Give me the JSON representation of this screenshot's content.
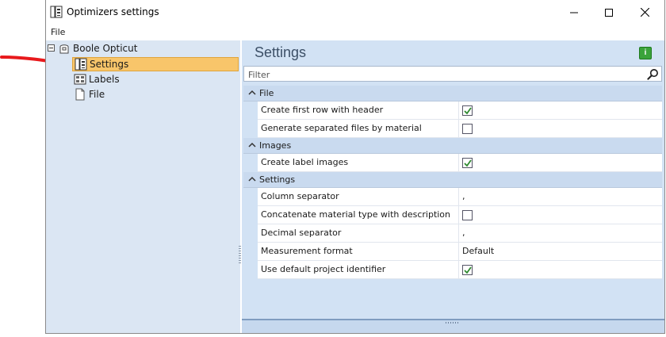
{
  "window": {
    "title": "Optimizers settings",
    "menu": {
      "file": "File"
    }
  },
  "tree": {
    "root": {
      "label": "Boole Opticut",
      "icon": "machine-icon"
    },
    "items": [
      {
        "label": "Settings",
        "icon": "settings-icon",
        "selected": true
      },
      {
        "label": "Labels",
        "icon": "labels-icon",
        "selected": false
      },
      {
        "label": "File",
        "icon": "file-icon",
        "selected": false
      }
    ]
  },
  "panel": {
    "title": "Settings",
    "info_button": "i",
    "filter_placeholder": "Filter"
  },
  "categories": [
    {
      "label": "File",
      "rows": [
        {
          "name": "Create first row with header",
          "type": "checkbox",
          "checked": true
        },
        {
          "name": "Generate separated files by material",
          "type": "checkbox",
          "checked": false
        }
      ]
    },
    {
      "label": "Images",
      "rows": [
        {
          "name": "Create label images",
          "type": "checkbox",
          "checked": true
        }
      ]
    },
    {
      "label": "Settings",
      "rows": [
        {
          "name": "Column separator",
          "type": "text",
          "value": ","
        },
        {
          "name": "Concatenate material type with description",
          "type": "checkbox",
          "checked": false
        },
        {
          "name": "Decimal separator",
          "type": "text",
          "value": ","
        },
        {
          "name": "Measurement format",
          "type": "text",
          "value": "Default"
        },
        {
          "name": "Use default project identifier",
          "type": "checkbox",
          "checked": true
        }
      ]
    }
  ],
  "colors": {
    "tree_bg": "#dbe6f3",
    "panel_bg": "#d2e2f4",
    "selection": "#f8c56a",
    "arrow": "#e8191c",
    "check": "#2f8a2f"
  }
}
